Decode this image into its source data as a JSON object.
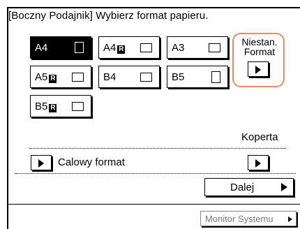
{
  "header": {
    "title": "[Boczny Podajnik] Wybierz format papieru."
  },
  "paper_sizes": [
    {
      "name": "A4",
      "suffix": "",
      "orientation": "portrait",
      "selected": true
    },
    {
      "name": "A4",
      "suffix": "R",
      "orientation": "landscape",
      "selected": false
    },
    {
      "name": "A3",
      "suffix": "",
      "orientation": "landscape",
      "selected": false
    },
    {
      "name": "A5",
      "suffix": "R",
      "orientation": "landscape",
      "selected": false
    },
    {
      "name": "B4",
      "suffix": "",
      "orientation": "landscape",
      "selected": false
    },
    {
      "name": "B5",
      "suffix": "",
      "orientation": "portrait",
      "selected": false
    },
    {
      "name": "B5",
      "suffix": "R",
      "orientation": "landscape",
      "selected": false
    }
  ],
  "nonstandard": {
    "label_line1": "Niestan.",
    "label_line2": "Format"
  },
  "envelope": {
    "label": "Koperta"
  },
  "inch_format": {
    "label": "Calowy format"
  },
  "next_button": {
    "label": "Dalej"
  },
  "system_monitor": {
    "label": "Monitor Systemu"
  },
  "colors": {
    "highlight": "#e98a60",
    "selected_bg": "#000000",
    "disabled_text": "#777777"
  },
  "icons": [
    "right-triangle-icon",
    "portrait-paper-icon",
    "landscape-paper-icon"
  ]
}
